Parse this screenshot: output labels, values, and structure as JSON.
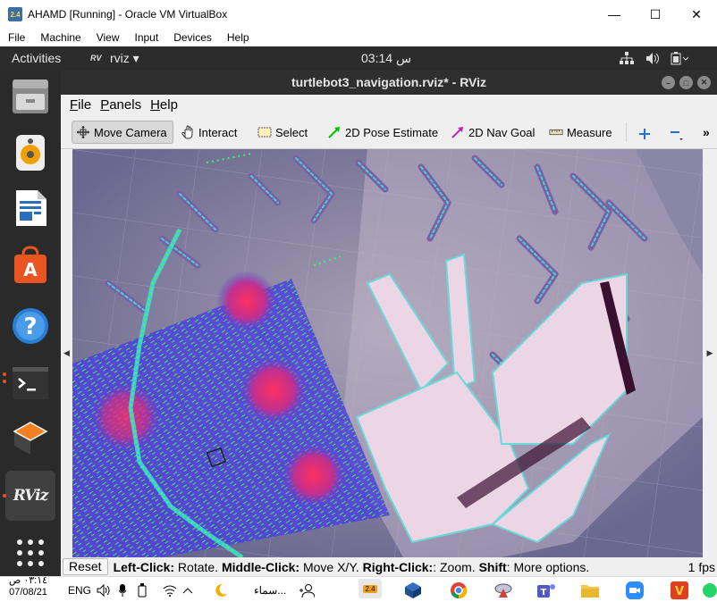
{
  "virtualbox": {
    "title": "AHAMD [Running] - Oracle VM VirtualBox",
    "icon_label": "2.4",
    "controls": {
      "minimize": "—",
      "maximize": "☐",
      "close": "✕"
    },
    "menu": [
      "File",
      "Machine",
      "View",
      "Input",
      "Devices",
      "Help"
    ]
  },
  "ubuntu_topbar": {
    "activities": "Activities",
    "app_menu": "rviz ▾",
    "clock": "03:14 س",
    "tray_icons": [
      "network-icon",
      "volume-icon",
      "battery-icon"
    ]
  },
  "dock": {
    "items": [
      "files-icon",
      "rhythmbox-icon",
      "libreoffice-writer-icon",
      "ubuntu-software-icon",
      "help-icon",
      "terminal-icon",
      "virtualbox-icon",
      "rviz-icon",
      "app-grid-icon"
    ],
    "rviz_label": "RViz"
  },
  "rviz": {
    "title": "turtlebot3_navigation.rviz* - RViz",
    "menu": [
      {
        "first": "F",
        "rest": "ile"
      },
      {
        "first": "P",
        "rest": "anels"
      },
      {
        "first": "H",
        "rest": "elp"
      }
    ],
    "tools": {
      "move_camera": "Move Camera",
      "interact": "Interact",
      "select": "Select",
      "pose_estimate": "2D Pose Estimate",
      "nav_goal": "2D Nav Goal",
      "measure": "Measure",
      "more": "»"
    },
    "colors": {
      "pose_estimate": "#00c000",
      "nav_goal": "#c020c0",
      "costmap": "#5040e0",
      "map_free": "#e8d4e4",
      "laser": "#40ff40"
    },
    "status": {
      "reset": "Reset",
      "k1": "Left-Click:",
      "v1": "Rotate.",
      "k2": "Middle-Click:",
      "v2": "Move X/Y.",
      "k3": "Right-Click:",
      "v3": ": Zoom.",
      "k4": "Shift",
      "v4": ": More options.",
      "fps": "1 fps"
    }
  },
  "taskbar": {
    "clock_time": "٠٣:١٤ ص",
    "clock_date": "07/08/21",
    "language": "ENG",
    "weather": "سماء...",
    "vb_badge": "2.4",
    "apps": [
      "virtualbox-icon",
      "chrome-icon",
      "satellite-icon",
      "teams-icon",
      "file-explorer-icon",
      "zoom-icon",
      "game-icon",
      "whatsapp-icon"
    ]
  }
}
